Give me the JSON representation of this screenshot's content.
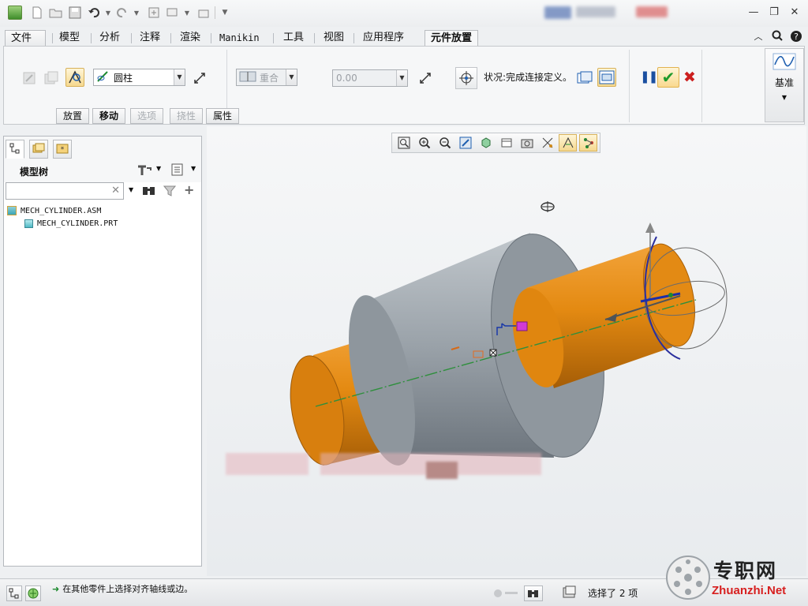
{
  "ribbon_tabs": [
    {
      "label": "文件"
    },
    {
      "label": "模型"
    },
    {
      "label": "分析"
    },
    {
      "label": "注释"
    },
    {
      "label": "渲染"
    },
    {
      "label": "Manikin"
    },
    {
      "label": "工具"
    },
    {
      "label": "视图"
    },
    {
      "label": "应用程序"
    },
    {
      "label": "元件放置",
      "active": true
    }
  ],
  "placement": {
    "constraint_type": "圆柱",
    "constraint_option": "重合",
    "offset_value": "0.00",
    "status_text": "状况:完成连接定义。",
    "datum_label": "基准"
  },
  "sub_tabs": [
    {
      "label": "放置",
      "state": "normal"
    },
    {
      "label": "移动",
      "state": "active"
    },
    {
      "label": "选项",
      "state": "disabled"
    },
    {
      "label": "挠性",
      "state": "disabled"
    },
    {
      "label": "属性",
      "state": "normal"
    }
  ],
  "model_tree": {
    "title": "模型树",
    "search_value": "",
    "items": [
      {
        "label": "MECH_CYLINDER.ASM",
        "type": "assembly"
      },
      {
        "label": "MECH_CYLINDER.PRT",
        "type": "part"
      }
    ]
  },
  "status_bar": {
    "message": "在其他零件上选择对齐轴线或边。",
    "selection_count": "选择了 2 项"
  },
  "watermark": {
    "cn": "专职网",
    "en": "Zhuanzhi.Net"
  },
  "colors": {
    "accent_ok": "#1f9a2c",
    "cancel": "#cc1f1f",
    "part_orange": "#e48a12",
    "part_grey": "#9aa2a9"
  },
  "icons": {
    "quick_access": [
      "app-icon",
      "new-icon",
      "open-icon",
      "save-icon",
      "undo-icon",
      "redo-icon",
      "regenerate-icon",
      "windows-icon",
      "close-window-icon",
      "customize-icon"
    ],
    "view_toolbar": [
      "refit-icon",
      "zoom-in-icon",
      "zoom-out-icon",
      "repaint-icon",
      "display-style-icon",
      "saved-views-icon",
      "view-manager-icon",
      "datum-display-icon",
      "spin-center-icon",
      "annotation-icon"
    ]
  }
}
